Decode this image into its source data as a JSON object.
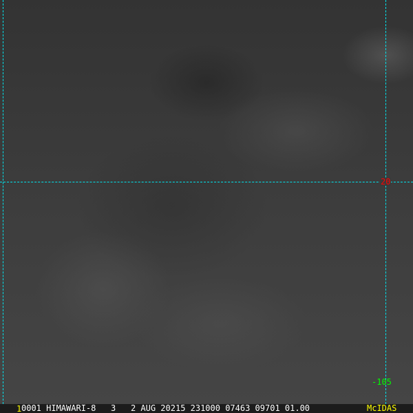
{
  "overlay": {
    "lat_label": "20",
    "lon_label": "-105",
    "grid_color": "#00e5ee",
    "lat_label_color": "#ff0000",
    "lon_label_color": "#00ff00"
  },
  "status_bar": {
    "frame_number": "1",
    "info": "0001 HIMAWARI-8   3   2 AUG 20215 231000 07463 09701 01.00",
    "brand": "McIDAS",
    "highlight_color": "#ffff00"
  }
}
